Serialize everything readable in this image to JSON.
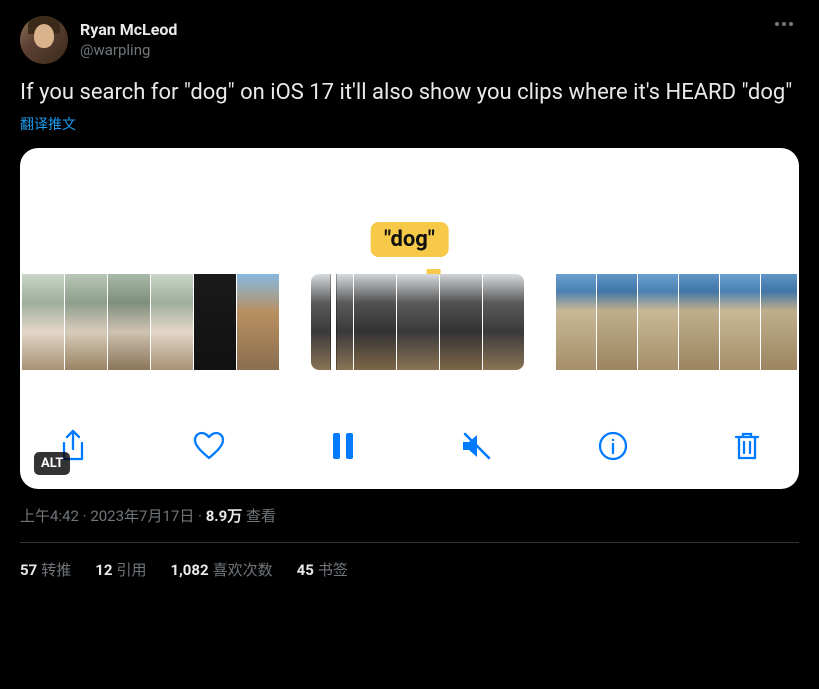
{
  "user": {
    "display_name": "Ryan McLeod",
    "handle": "@warpling"
  },
  "tweet_text": "If you search for \"dog\" on iOS 17 it'll also show you clips where it's HEARD \"dog\"",
  "translate_label": "翻译推文",
  "media": {
    "search_bubble": "\"dog\"",
    "alt_badge": "ALT"
  },
  "meta": {
    "time": "上午4:42",
    "dot1": " · ",
    "date": "2023年7月17日",
    "dot2": " · ",
    "views_count": "8.9万",
    "views_label": " 查看"
  },
  "stats": {
    "retweets_count": "57",
    "retweets_label": "转推",
    "quotes_count": "12",
    "quotes_label": "引用",
    "likes_count": "1,082",
    "likes_label": "喜欢次数",
    "bookmarks_count": "45",
    "bookmarks_label": "书签"
  }
}
